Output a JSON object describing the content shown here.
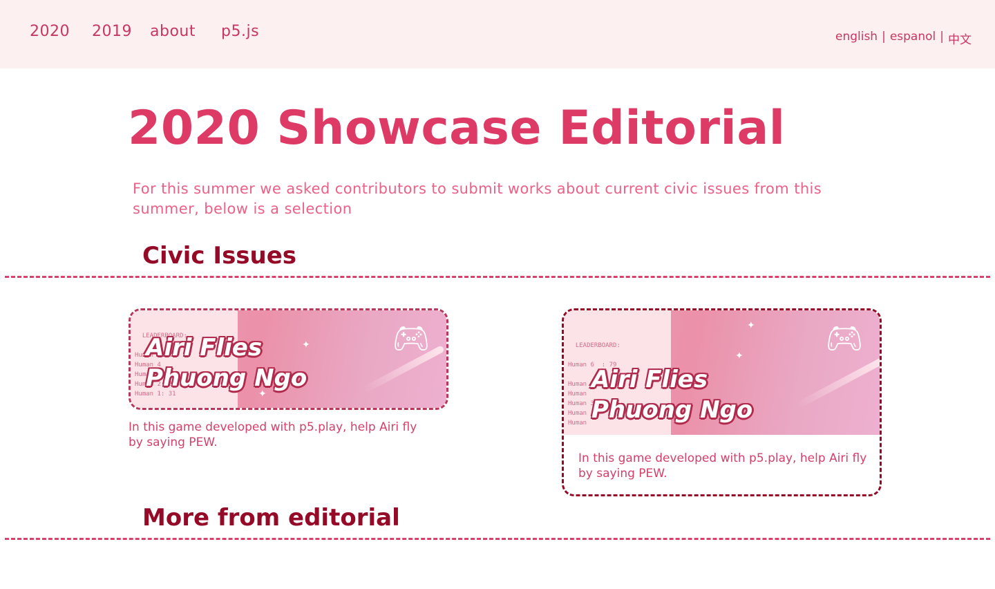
{
  "nav": {
    "links": [
      "2020",
      "2019",
      "about",
      "p5.js"
    ],
    "languages": [
      "english",
      "espanol",
      "中文"
    ],
    "separator": "|"
  },
  "page": {
    "title": "2020 Showcase Editorial",
    "intro": "For this summer we asked contributors to submit works about current civic issues from this summer, below is a selection"
  },
  "sections": {
    "civic": "Civic Issues",
    "more": "More from editorial"
  },
  "cards": [
    {
      "title": "Airi Flies",
      "author": "Phuong Ngo",
      "description": "In this game developed with p5.play, help Airi fly by saying PEW.",
      "icon": "gamepad-icon"
    },
    {
      "title": "Airi Flies",
      "author": "Phuong Ngo",
      "description": "In this game developed with p5.play, help Airi fly by saying PEW.",
      "icon": "gamepad-icon"
    }
  ],
  "colors": {
    "accent": "#dd3a65",
    "heading": "#950a27",
    "topbar": "#fdf0f1"
  }
}
